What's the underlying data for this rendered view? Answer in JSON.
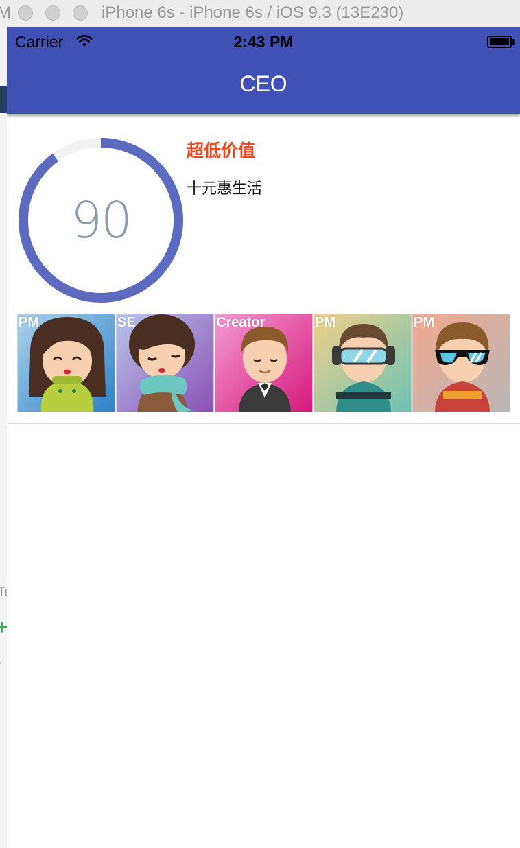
{
  "simulator": {
    "window_title": "iPhone 6s - iPhone 6s / iOS 9.3 (13E230)",
    "behind_fragment": "M",
    "behind_fragment_2": "Te"
  },
  "status_bar": {
    "carrier": "Carrier",
    "time": "2:43 PM",
    "icons": [
      "wifi-icon",
      "battery-icon"
    ]
  },
  "nav": {
    "title": "CEO",
    "color": "#3f51b5"
  },
  "gauge": {
    "value": "90",
    "percent": 90,
    "track_color": "#f2f2f2",
    "progress_color": "#5c6bc0"
  },
  "promo": {
    "title": "超低价值",
    "subtitle": "十元惠生活",
    "title_color": "#f1461c"
  },
  "team": [
    {
      "role": "PM",
      "icon": "girl-avatar-icon"
    },
    {
      "role": "SE",
      "icon": "girl-scarf-avatar-icon"
    },
    {
      "role": "Creator",
      "icon": "man-suit-avatar-icon"
    },
    {
      "role": "PM",
      "icon": "man-goggles-avatar-icon"
    },
    {
      "role": "PM",
      "icon": "man-sunglasses-avatar-icon"
    }
  ]
}
